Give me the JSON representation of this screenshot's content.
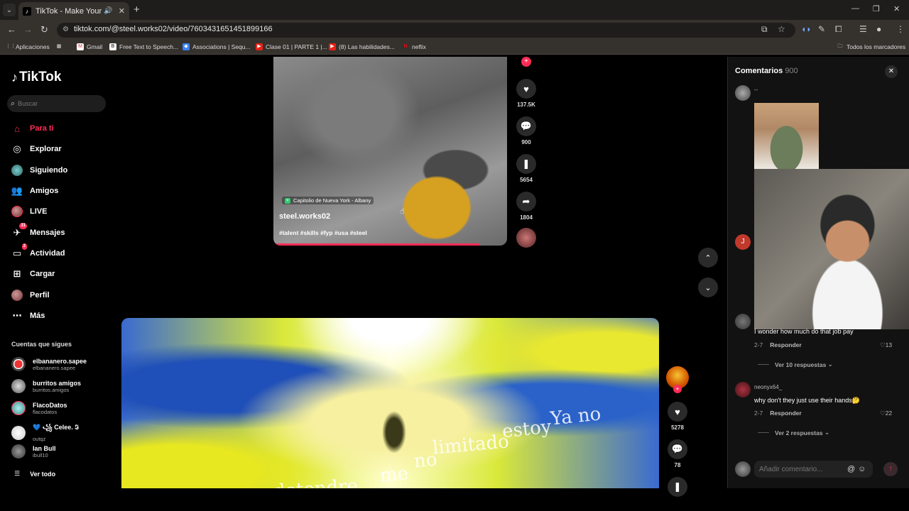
{
  "browser": {
    "tab_title": "TikTok - Make Your Day",
    "url": "tiktok.com/@steel.works02/video/7603431651451899166",
    "bookmarks": [
      {
        "label": "Aplicaciones"
      },
      {
        "label": "Gmail"
      },
      {
        "label": "Free Text to Speech..."
      },
      {
        "label": "Associations | Sequ..."
      },
      {
        "label": "Clase 01 | PARTE 1 |..."
      },
      {
        "label": "(8) Las habilidades..."
      },
      {
        "label": "neflix"
      }
    ],
    "all_bookmarks": "Todos los marcadores"
  },
  "sidebar": {
    "logo": "TikTok",
    "search_placeholder": "Buscar",
    "nav": [
      {
        "label": "Para ti"
      },
      {
        "label": "Explorar"
      },
      {
        "label": "Siguiendo"
      },
      {
        "label": "Amigos"
      },
      {
        "label": "LIVE"
      },
      {
        "label": "Mensajes",
        "badge": "31"
      },
      {
        "label": "Actividad",
        "badge": "2"
      },
      {
        "label": "Cargar"
      },
      {
        "label": "Perfil"
      },
      {
        "label": "Más"
      }
    ],
    "following_title": "Cuentas que sigues",
    "accounts": [
      {
        "name": "elbananero.sapee",
        "handle": "elbananero.sapee"
      },
      {
        "name": "burritos amigos",
        "handle": "burritos.amigos"
      },
      {
        "name": "FlacoDatos",
        "handle": "flacodatos"
      },
      {
        "name": "💙 ꧁ Celee. 𝕴",
        "handle": "outqz"
      },
      {
        "name": "Ian Bull",
        "handle": "ibull10"
      }
    ],
    "see_all": "Ver todo"
  },
  "video1": {
    "location": "Capitolio de Nueva York - Albany",
    "author": "steel.works02",
    "tags": "#talent #skills #fyp #usa #steel",
    "progress": 0.88,
    "likes": "137.5K",
    "comments": "900",
    "saves": "5654",
    "shares": "1804"
  },
  "video2": {
    "lyrics": [
      "Ya no",
      "estoy",
      "limitado",
      "no",
      "me",
      "detendre"
    ],
    "likes": "5278",
    "comments": "78"
  },
  "comments": {
    "title": "Comentarios",
    "count": "900",
    "first_user": "--",
    "items": [
      {
        "user": "",
        "text": "I wonder how much do that job pay",
        "date": "2-7",
        "reply": "Responder",
        "likes": "13",
        "view_replies": "Ver 10 respuestas"
      },
      {
        "user": "neonyx64_",
        "text": "why don't they just use their hands🤔",
        "date": "2-7",
        "reply": "Responder",
        "likes": "22",
        "view_replies": "Ver 2 respuestas"
      }
    ],
    "avatar_initial": "J",
    "input_placeholder": "Añadir comentario..."
  }
}
